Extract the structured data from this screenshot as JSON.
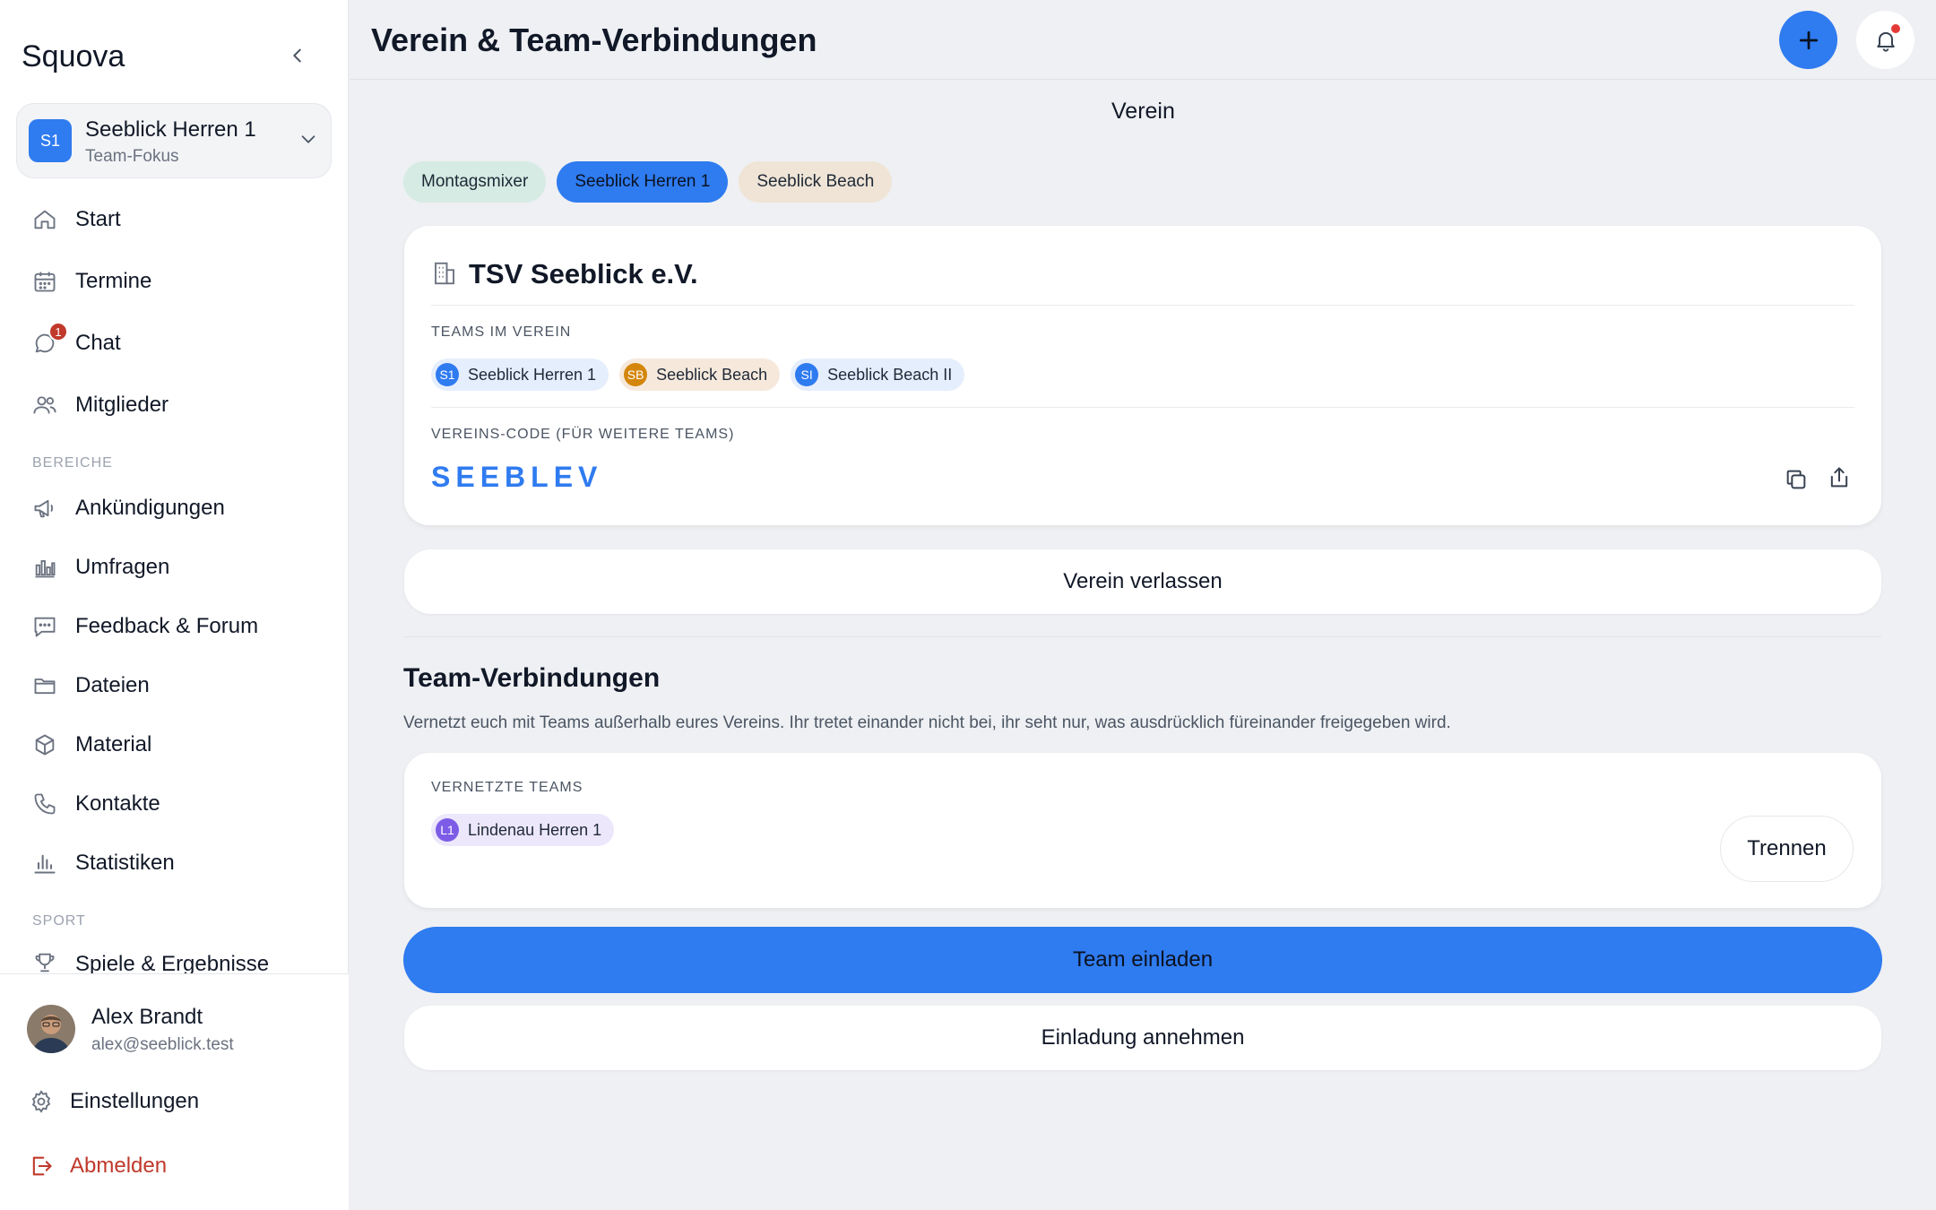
{
  "app": {
    "name": "Squova"
  },
  "team_switcher": {
    "initials": "S1",
    "name": "Seeblick Herren 1",
    "subtitle": "Team-Fokus"
  },
  "nav": {
    "main": [
      {
        "label": "Start",
        "icon": "home-icon"
      },
      {
        "label": "Termine",
        "icon": "calendar-icon"
      },
      {
        "label": "Chat",
        "icon": "chat-icon",
        "badge": "1"
      },
      {
        "label": "Mitglieder",
        "icon": "users-icon"
      }
    ],
    "section_bereiche": "BEREICHE",
    "bereiche": [
      {
        "label": "Ankündigungen",
        "icon": "megaphone-icon"
      },
      {
        "label": "Umfragen",
        "icon": "poll-icon"
      },
      {
        "label": "Feedback & Forum",
        "icon": "message-icon"
      },
      {
        "label": "Dateien",
        "icon": "folder-icon"
      },
      {
        "label": "Material",
        "icon": "box-icon"
      },
      {
        "label": "Kontakte",
        "icon": "phone-icon"
      },
      {
        "label": "Statistiken",
        "icon": "stats-icon"
      }
    ],
    "section_sport": "SPORT",
    "sport": [
      {
        "label": "Spiele & Ergebnisse",
        "icon": "trophy-icon"
      }
    ]
  },
  "user": {
    "name": "Alex Brandt",
    "email": "alex@seeblick.test"
  },
  "footer": {
    "settings": "Einstellungen",
    "logout": "Abmelden"
  },
  "header": {
    "title": "Verein & Team-Verbindungen"
  },
  "main": {
    "section_title": "Verein",
    "tabs": [
      "Montagsmixer",
      "Seeblick Herren 1",
      "Seeblick Beach"
    ],
    "club": {
      "name": "TSV Seeblick e.V.",
      "teams_caption": "TEAMS IM VEREIN",
      "teams": [
        {
          "initials": "S1",
          "name": "Seeblick Herren 1"
        },
        {
          "initials": "SB",
          "name": "Seeblick Beach"
        },
        {
          "initials": "SI",
          "name": "Seeblick Beach II"
        }
      ],
      "code_caption": "VEREINS-CODE (FÜR WEITERE TEAMS)",
      "code": "SEEBLEV"
    },
    "leave_label": "Verein verlassen",
    "connections": {
      "title": "Team-Verbindungen",
      "description": "Vernetzt euch mit Teams außerhalb eures Vereins. Ihr tretet einander nicht bei, ihr seht nur, was ausdrücklich füreinander freigegeben wird.",
      "caption": "VERNETZTE TEAMS",
      "teams": [
        {
          "initials": "L1",
          "name": "Lindenau Herren 1"
        }
      ],
      "disconnect_label": "Trennen"
    },
    "invite_label": "Team einladen",
    "accept_label": "Einladung annehmen"
  },
  "colors": {
    "accent": "#2f7bf0",
    "danger": "#c0392b"
  }
}
